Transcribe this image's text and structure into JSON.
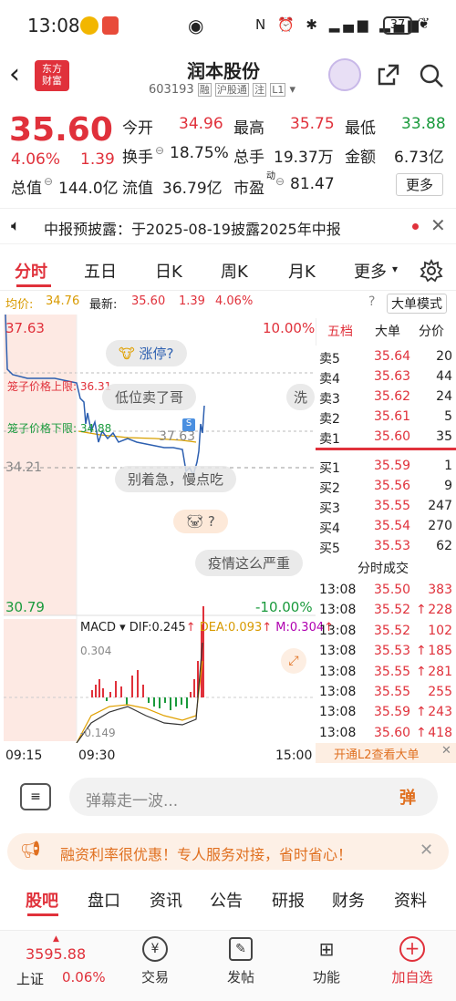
{
  "status": {
    "time": "13:08",
    "battery": "37"
  },
  "header": {
    "title": "润本股份",
    "code": "603193",
    "tags": [
      "融",
      "沪股通",
      "注",
      "L1"
    ],
    "logo_text": "东方\n财富"
  },
  "quote": {
    "price": "35.60",
    "change_pct": "4.06%",
    "change": "1.39",
    "open_label": "今开",
    "open": "34.96",
    "high_label": "最高",
    "high": "35.75",
    "low_label": "最低",
    "low": "33.88",
    "turnover_label": "换手",
    "turnover": "18.75%",
    "volume_label": "总手",
    "volume": "19.37万",
    "amount_label": "金额",
    "amount": "6.73亿",
    "mcap_label": "总值",
    "mcap": "144.0亿",
    "float_label": "流值",
    "float": "36.79亿",
    "pe_label": "市盈",
    "pe_sup": "动",
    "pe": "81.47",
    "more_label": "更多"
  },
  "notice": {
    "text": "中报预披露：于2025-08-19披露2025年中报"
  },
  "tabs": {
    "items": [
      "分时",
      "五日",
      "日K",
      "周K",
      "月K",
      "更多"
    ],
    "active": 0
  },
  "chart": {
    "avg_label": "均价:",
    "avg": "34.76",
    "latest_label": "最新:",
    "latest": "35.60",
    "latest_chg": "1.39",
    "latest_pct": "4.06%",
    "big_order_label": "大单模式",
    "y_top": "37.63",
    "y_bottom": "30.79",
    "y_mid": "34.21",
    "pct_top": "10.00%",
    "pct_bottom": "-10.00%",
    "cage_upper": "笼子价格上限: 36.31",
    "cage_lower": "笼子价格下限: 34.88",
    "float_price": "37.63",
    "danmu": [
      "涨停?",
      "低位卖了哥",
      "洗",
      "别着急，慢点吃",
      "?",
      "疫情这么严重"
    ],
    "macd_label": "MACD",
    "dif": "DIF:0.245",
    "dea": "DEA:0.093",
    "m": "M:0.304",
    "macd_top": "0.304",
    "macd_bottom": "-0.149",
    "time_start": "09:15",
    "time_mid": "09:30",
    "time_end": "15:00"
  },
  "orderbook": {
    "tabs": [
      "五档",
      "大单",
      "分价"
    ],
    "asks": [
      {
        "label": "卖5",
        "price": "35.64",
        "vol": "20"
      },
      {
        "label": "卖4",
        "price": "35.63",
        "vol": "44"
      },
      {
        "label": "卖3",
        "price": "35.62",
        "vol": "24"
      },
      {
        "label": "卖2",
        "price": "35.61",
        "vol": "5"
      },
      {
        "label": "卖1",
        "price": "35.60",
        "vol": "35"
      }
    ],
    "bids": [
      {
        "label": "买1",
        "price": "35.59",
        "vol": "1"
      },
      {
        "label": "买2",
        "price": "35.56",
        "vol": "9"
      },
      {
        "label": "买3",
        "price": "35.55",
        "vol": "247"
      },
      {
        "label": "买4",
        "price": "35.54",
        "vol": "270"
      },
      {
        "label": "买5",
        "price": "35.53",
        "vol": "62"
      }
    ],
    "trades_title": "分时成交",
    "trades": [
      {
        "time": "13:08",
        "price": "35.50",
        "arrow": "",
        "vol": "383",
        "color": "#e0313b"
      },
      {
        "time": "13:08",
        "price": "35.52",
        "arrow": "↑",
        "vol": "228",
        "color": "#e0313b"
      },
      {
        "time": "13:08",
        "price": "35.52",
        "arrow": "",
        "vol": "102",
        "color": "#e0313b"
      },
      {
        "time": "13:08",
        "price": "35.53",
        "arrow": "↑",
        "vol": "185",
        "color": "#e0313b"
      },
      {
        "time": "13:08",
        "price": "35.55",
        "arrow": "↑",
        "vol": "281",
        "color": "#e0313b"
      },
      {
        "time": "13:08",
        "price": "35.55",
        "arrow": "",
        "vol": "255",
        "color": "#e0313b"
      },
      {
        "time": "13:08",
        "price": "35.59",
        "arrow": "↑",
        "vol": "243",
        "color": "#e0313b"
      },
      {
        "time": "13:08",
        "price": "35.60",
        "arrow": "↑",
        "vol": "418",
        "color": "#e0313b"
      }
    ],
    "l2_label": "开通L2查看大单"
  },
  "danmu_bar": {
    "placeholder": "弹幕走一波...",
    "button": "弹"
  },
  "promo": {
    "text": "融资利率很优惠！专人服务对接，省时省心！"
  },
  "subtabs": {
    "items": [
      "股吧",
      "盘口",
      "资讯",
      "公告",
      "研报",
      "财务",
      "资料"
    ],
    "active": 0
  },
  "footer": {
    "index_value": "3595.88",
    "index_name": "上证",
    "index_pct": "0.06%",
    "items": [
      "交易",
      "发帖",
      "功能",
      "加自选"
    ]
  }
}
